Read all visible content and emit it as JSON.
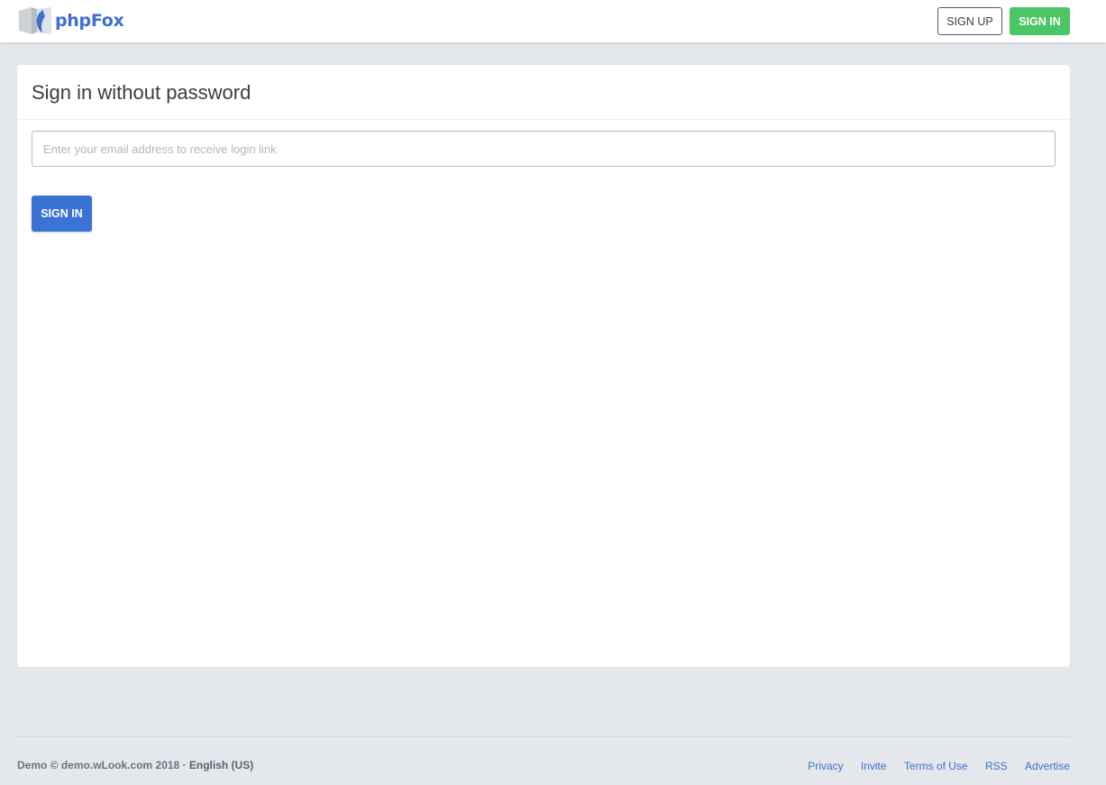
{
  "header": {
    "brand": "phpFox",
    "signup_label": "SIGN UP",
    "signin_label": "SIGN IN",
    "colors": {
      "brand": "#3e6fd1",
      "signin": "#4cc565"
    }
  },
  "card": {
    "title": "Sign in without password",
    "email_placeholder": "Enter your email address to receive login link",
    "email_value": "",
    "submit_label": "SIGN IN",
    "submit_color": "#3b73d4"
  },
  "footer": {
    "copyright": "Demo © demo.wLook.com 2018 · ",
    "language": "English (US)",
    "links": [
      "Privacy",
      "Invite",
      "Terms of Use",
      "RSS",
      "Advertise"
    ],
    "separator": "·"
  }
}
